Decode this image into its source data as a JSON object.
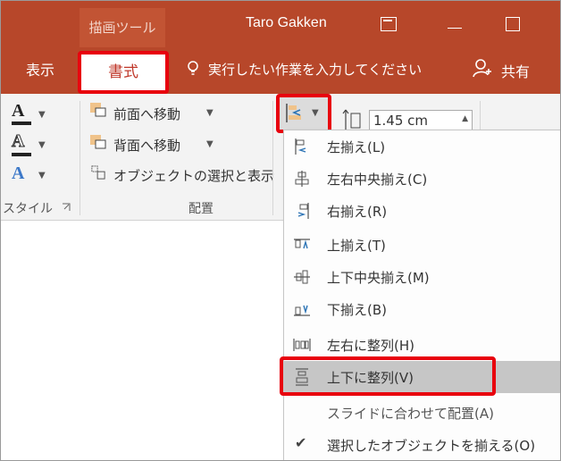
{
  "titlebar": {
    "context_tab": "描画ツール",
    "user_name": "Taro Gakken",
    "tabs": [
      {
        "label": "表示"
      },
      {
        "label": "書式"
      }
    ],
    "tell_me": "実行したい作業を入力してください",
    "share": "共有"
  },
  "ribbon": {
    "styles_group_label": "スタイル",
    "arrange_group_label": "配置",
    "bring_forward": "前面へ移動",
    "send_backward": "背面へ移動",
    "selection_pane": "オブジェクトの選択と表示",
    "width_value": "1.45 cm"
  },
  "align_menu": {
    "items": [
      {
        "label": "左揃え(L)",
        "icon": "align-left-icon"
      },
      {
        "label": "左右中央揃え(C)",
        "icon": "align-center-icon"
      },
      {
        "label": "右揃え(R)",
        "icon": "align-right-icon"
      },
      {
        "label": "上揃え(T)",
        "icon": "align-top-icon"
      },
      {
        "label": "上下中央揃え(M)",
        "icon": "align-middle-icon"
      },
      {
        "label": "下揃え(B)",
        "icon": "align-bottom-icon"
      },
      {
        "label": "左右に整列(H)",
        "icon": "distribute-horizontal-icon"
      },
      {
        "label": "上下に整列(V)",
        "icon": "distribute-vertical-icon"
      },
      {
        "label": "スライドに合わせて配置(A)",
        "icon": ""
      },
      {
        "label": "選択したオブジェクトを揃える(O)",
        "icon": "checkmark-icon"
      }
    ]
  },
  "colors": {
    "accent": "#b7472a",
    "highlight": "#e8000d"
  }
}
